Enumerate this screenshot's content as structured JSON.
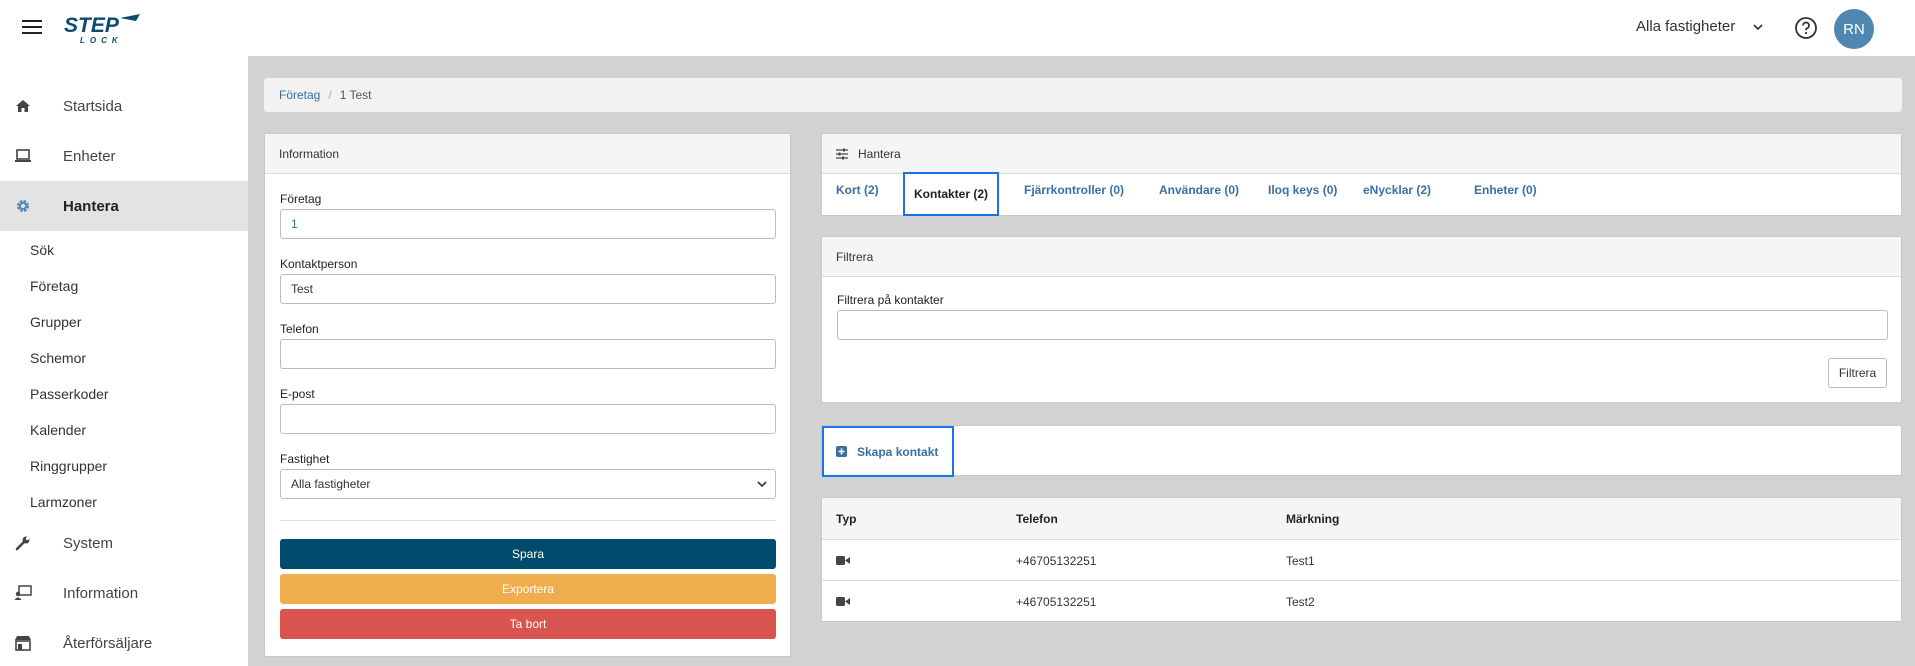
{
  "header": {
    "logo_top": "STEP",
    "logo_bottom": "LOCK",
    "property_selector": "Alla fastigheter",
    "avatar_initials": "RN",
    "avatar_color": "#4f87b0"
  },
  "sidebar": {
    "items": [
      {
        "label": "Startsida",
        "icon": "home-icon"
      },
      {
        "label": "Enheter",
        "icon": "laptop-icon"
      },
      {
        "label": "Hantera",
        "icon": "gear-icon"
      },
      {
        "label": "System",
        "icon": "wrench-icon"
      },
      {
        "label": "Information",
        "icon": "info-screen-icon"
      },
      {
        "label": "Återförsäljare",
        "icon": "store-icon"
      }
    ],
    "subitems": [
      "Sök",
      "Företag",
      "Grupper",
      "Schemor",
      "Passerkoder",
      "Kalender",
      "Ringgrupper",
      "Larmzoner"
    ]
  },
  "breadcrumb": {
    "parent": "Företag",
    "separator": "/",
    "current": "1 Test"
  },
  "info_card": {
    "title": "Information",
    "fields": [
      {
        "label": "Företag",
        "value": "1"
      },
      {
        "label": "Kontaktperson",
        "value": "Test"
      },
      {
        "label": "Telefon",
        "value": ""
      },
      {
        "label": "E-post",
        "value": ""
      },
      {
        "label": "Fastighet",
        "value": "Alla fastigheter"
      }
    ],
    "buttons": {
      "save": "Spara",
      "export": "Exportera",
      "delete": "Ta bort"
    },
    "colors": {
      "save": "#004b6b",
      "export": "#f0ad4e",
      "delete": "#d9534f"
    }
  },
  "manage_card": {
    "title": "Hantera",
    "tabs": [
      "Kort (2)",
      "Kontakter (2)",
      "Fjärrkontroller (0)",
      "Användare (0)",
      "Iloq keys (0)",
      "eNycklar (2)",
      "Enheter (0)"
    ],
    "active_tab": "Kontakter (2)"
  },
  "filter_card": {
    "title": "Filtrera",
    "label": "Filtrera på kontakter",
    "value": "",
    "button": "Filtrera"
  },
  "create_contact": {
    "label": "Skapa kontakt"
  },
  "contacts_table": {
    "headers": [
      "Typ",
      "Telefon",
      "Märkning"
    ],
    "rows": [
      {
        "type_icon": "video-camera-icon",
        "phone": "+46705132251",
        "label": "Test1"
      },
      {
        "type_icon": "video-camera-icon",
        "phone": "+46705132251",
        "label": "Test2"
      }
    ]
  }
}
